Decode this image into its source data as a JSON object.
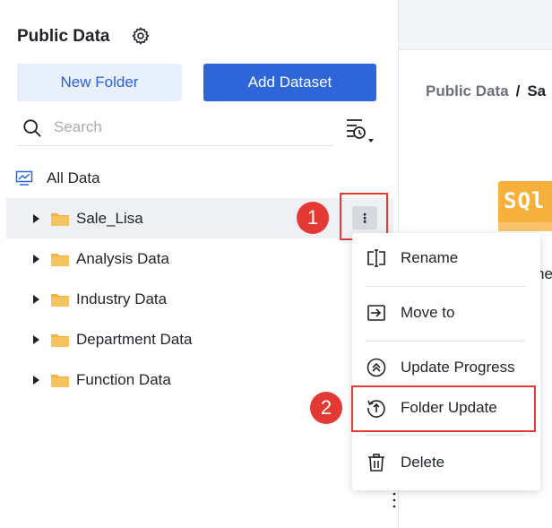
{
  "sidebar": {
    "title": "Public Data",
    "new_folder_label": "New Folder",
    "add_dataset_label": "Add Dataset",
    "search_placeholder": "Search",
    "all_data_label": "All Data",
    "folders": [
      {
        "label": "Sale_Lisa",
        "selected": true
      },
      {
        "label": "Analysis Data"
      },
      {
        "label": "Industry Data"
      },
      {
        "label": "Department Data"
      },
      {
        "label": "Function Data"
      }
    ]
  },
  "context_menu": {
    "items": [
      {
        "label": "Rename",
        "icon": "rename-icon"
      },
      {
        "label": "Move to",
        "icon": "move-to-icon"
      },
      {
        "label": "Update Progress",
        "icon": "update-progress-icon"
      },
      {
        "label": "Folder Update",
        "icon": "folder-update-icon"
      },
      {
        "label": "Delete",
        "icon": "trash-icon"
      }
    ]
  },
  "annotations": {
    "step1": "1",
    "step2": "2"
  },
  "main": {
    "breadcrumb_root": "Public Data",
    "breadcrumb_sep": "/",
    "breadcrumb_current": "Sa",
    "card_thumb_text": "SQl",
    "card_label_partial": "he"
  },
  "colors": {
    "accent": "#2e65d8",
    "highlight": "#e53935",
    "folder": "#f5b13c"
  }
}
